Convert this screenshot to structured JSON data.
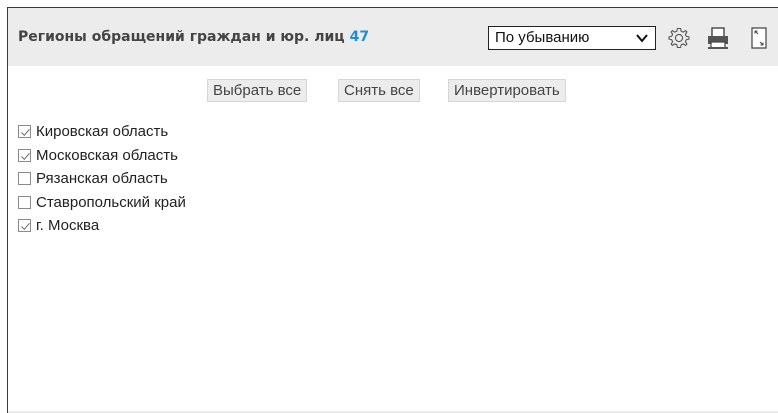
{
  "header": {
    "title": "Регионы обращений граждан и юр. лиц",
    "count": "47",
    "sort_selected": "По убыванию",
    "icons": [
      "gear-icon",
      "printer-icon",
      "expand-icon"
    ],
    "count_color": "#1b8ed8"
  },
  "actions": {
    "select_all": "Выбрать все",
    "clear_all": "Снять все",
    "invert": "Инвертировать"
  },
  "regions": [
    {
      "label": "Кировская область",
      "checked": true
    },
    {
      "label": "Московская область",
      "checked": true
    },
    {
      "label": "Рязанская область",
      "checked": false
    },
    {
      "label": "Ставропольский край",
      "checked": false
    },
    {
      "label": "г. Москва",
      "checked": true
    }
  ]
}
